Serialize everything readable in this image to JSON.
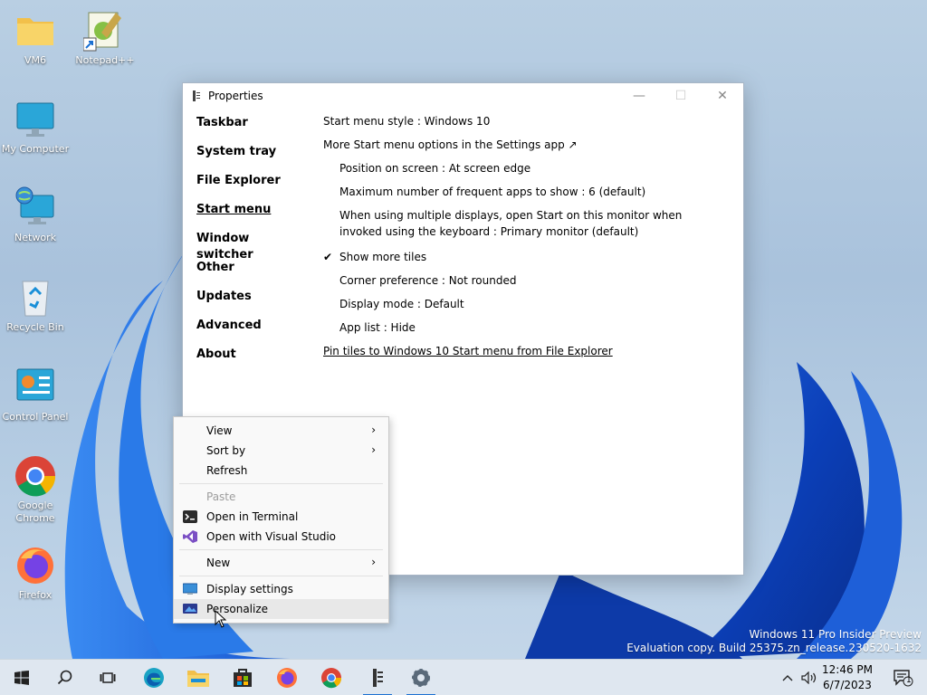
{
  "desktop": {
    "icons": [
      {
        "label": "VM6",
        "icon": "folder-icon"
      },
      {
        "label": "Notepad++",
        "icon": "notepad-plus-plus-icon"
      },
      {
        "label": "My Computer",
        "icon": "monitor-icon"
      },
      {
        "label": "Network",
        "icon": "network-globe-icon"
      },
      {
        "label": "Recycle Bin",
        "icon": "recycle-bin-icon"
      },
      {
        "label": "Control Panel",
        "icon": "control-panel-icon"
      },
      {
        "label": "Google Chrome",
        "icon": "chrome-icon"
      },
      {
        "label": "Firefox",
        "icon": "firefox-icon"
      }
    ]
  },
  "window": {
    "title": "Properties",
    "controls": {
      "minimize": "—",
      "maximize": "☐",
      "close": "✕"
    },
    "nav": [
      "Taskbar",
      "System tray",
      "File Explorer",
      "Start menu",
      "Window switcher",
      "Other",
      "Updates",
      "Advanced",
      "About"
    ],
    "content": {
      "start_menu_style": "Start menu style : Windows 10",
      "more_options": "More Start menu options in the Settings app ↗",
      "position": "Position on screen : At screen edge",
      "max_frequent": "Maximum number of frequent apps to show : 6 (default)",
      "multi_display": "When using multiple displays, open Start on this monitor when invoked using the keyboard : Primary monitor (default)",
      "check_mark": "✔",
      "show_more_tiles": "Show more tiles",
      "corner_pref": "Corner preference : Not rounded",
      "display_mode": "Display mode : Default",
      "app_list": "App list : Hide",
      "pin_tiles": "Pin tiles to Windows 10 Start menu from File Explorer"
    }
  },
  "context_menu": {
    "view": "View",
    "sort_by": "Sort by",
    "refresh": "Refresh",
    "paste": "Paste",
    "open_terminal": "Open in Terminal",
    "open_vs": "Open with Visual Studio",
    "new": "New",
    "display_settings": "Display settings",
    "personalize": "Personalize",
    "arrow": "›"
  },
  "watermark": {
    "line1": "Windows 11 Pro Insider Preview",
    "line2": "Evaluation copy. Build 25375.zn_release.230520-1632"
  },
  "taskbar": {
    "apps": [
      "start-icon",
      "search-icon",
      "task-view-icon",
      "edge-icon",
      "file-explorer-icon",
      "store-icon",
      "firefox-icon",
      "chrome-icon",
      "properties-app-icon",
      "settings-icon"
    ],
    "time": "12:46 PM",
    "date": "6/7/2023",
    "notifications_count": "1",
    "colors": {
      "accent": "#1a6fd1",
      "taskbar_bg": "#dfe7f0"
    }
  }
}
